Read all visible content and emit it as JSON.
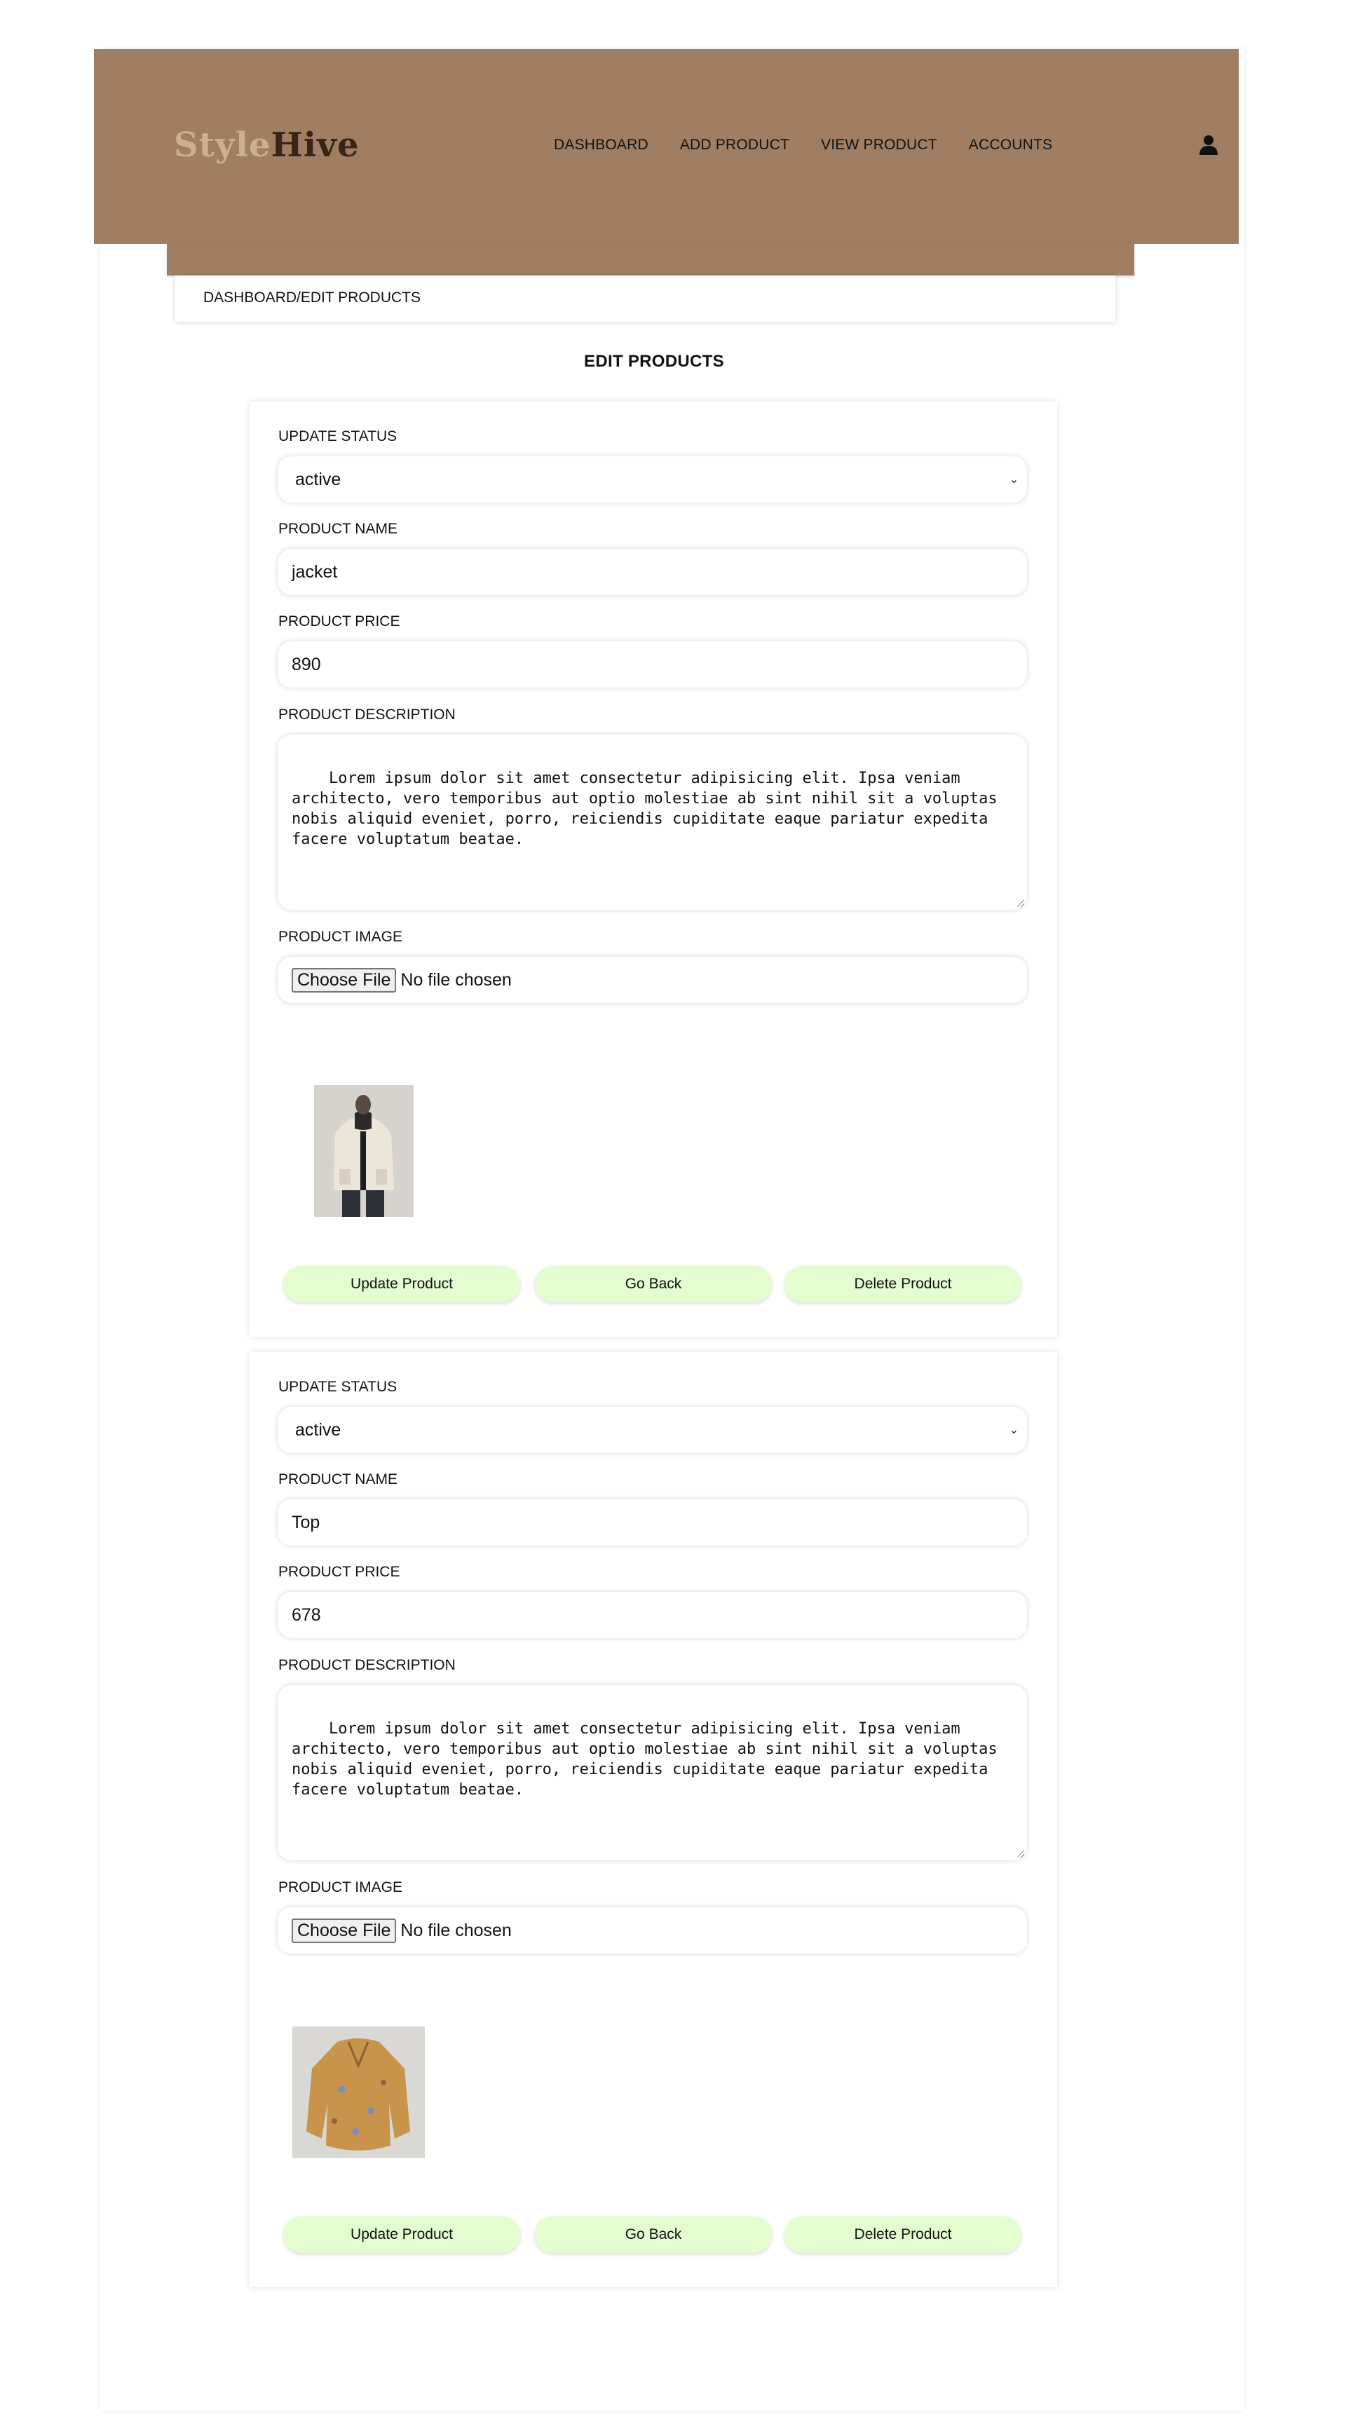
{
  "app": {
    "logo_part1": "Style",
    "logo_part2": "Hive"
  },
  "nav": {
    "items": [
      "DASHBOARD",
      "ADD PRODUCT",
      "VIEW PRODUCT",
      "ACCOUNTS"
    ]
  },
  "icons": {
    "user": "user-icon",
    "select": "chevron-down-icon"
  },
  "colors": {
    "header_bg": "#9f7e63",
    "logo_light": "#c9b08f",
    "logo_dark": "#3a2318",
    "button_bg": "#e3fdd1"
  },
  "breadcrumb": "DASHBOARD/EDIT PRODUCTS",
  "page_title": "EDIT PRODUCTS",
  "labels": {
    "status": "UPDATE STATUS",
    "name": "PRODUCT NAME",
    "price": "PRODUCT PRICE",
    "description": "PRODUCT DESCRIPTION",
    "image": "PRODUCT IMAGE",
    "choose_file": "Choose File",
    "no_file": "No file chosen",
    "update_button": "Update Product",
    "back_button": "Go Back",
    "delete_button": "Delete Product"
  },
  "products": [
    {
      "status": "active",
      "name": "jacket",
      "price": "890",
      "description": "Lorem ipsum dolor sit amet consectetur adipisicing elit. Ipsa veniam architecto, vero temporibus aut optio molestiae ab sint nihil sit a voluptas nobis aliquid eveniet, porro, reiciendis cupiditate eaque pariatur expedita facere voluptatum beatae.",
      "image": "cream jacket photo"
    },
    {
      "status": "active",
      "name": "Top",
      "price": "678",
      "description": "Lorem ipsum dolor sit amet consectetur adipisicing elit. Ipsa veniam architecto, vero temporibus aut optio molestiae ab sint nihil sit a voluptas nobis aliquid eveniet, porro, reiciendis cupiditate eaque pariatur expedita facere voluptatum beatae.",
      "image": "mustard floral top photo"
    }
  ]
}
